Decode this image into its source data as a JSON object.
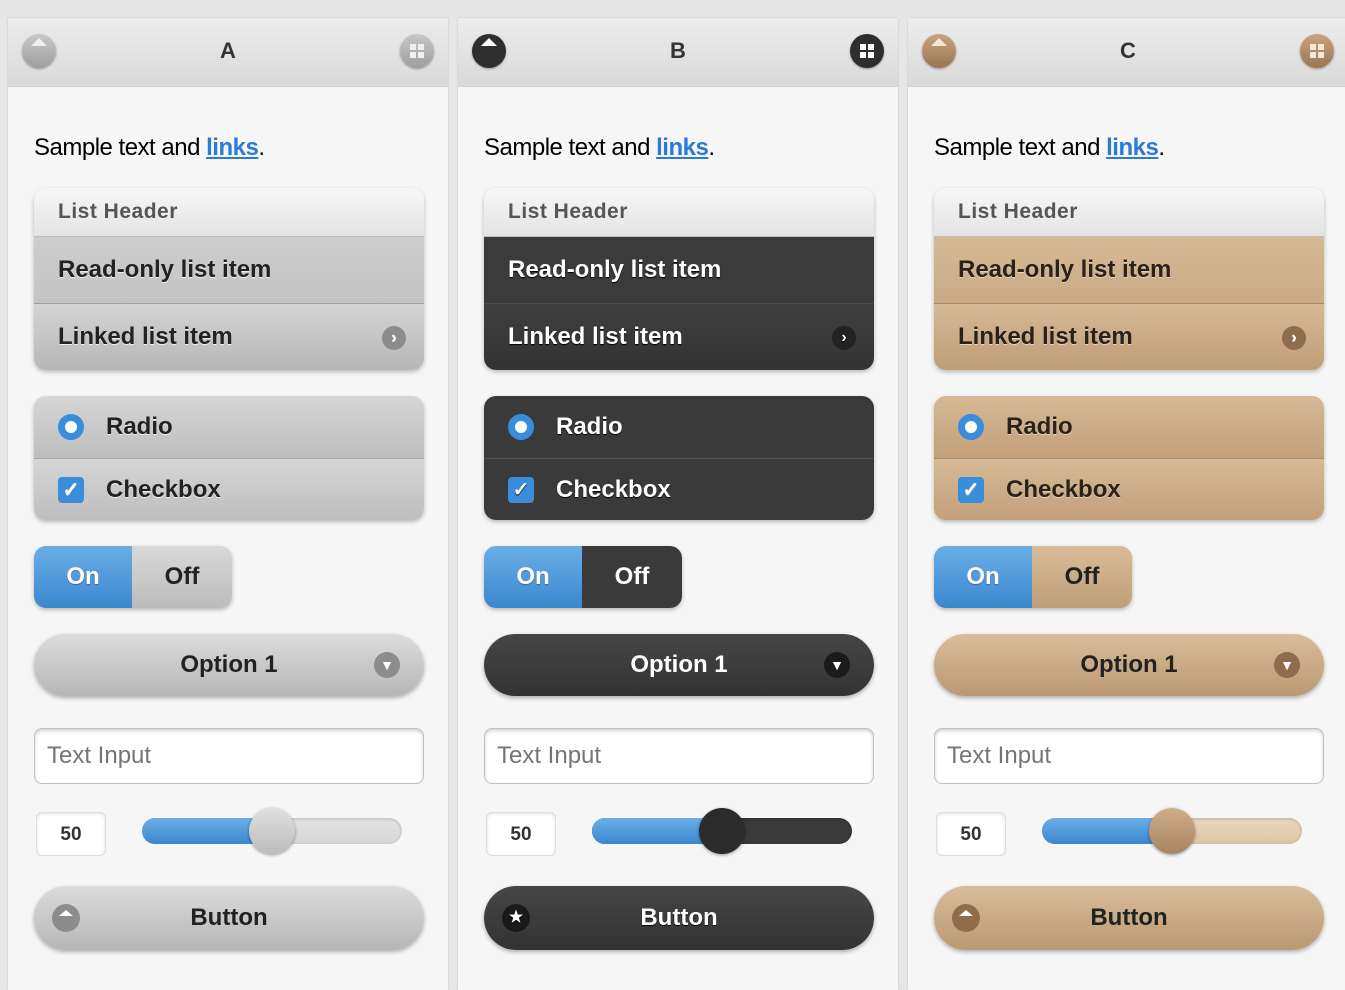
{
  "panels": [
    {
      "theme": "A",
      "title": "A",
      "sample_text": "Sample text and ",
      "link_text": "links",
      "sample_suffix": ".",
      "list_header": "List Header",
      "readonly_item": "Read-only list item",
      "linked_item": "Linked list item",
      "radio_label": "Radio",
      "checkbox_label": "Checkbox",
      "toggle_on": "On",
      "toggle_off": "Off",
      "select_value": "Option 1",
      "text_input_placeholder": "Text Input",
      "slider_value": "50",
      "slider_fraction": 0.5,
      "button_label": "Button",
      "icons": {
        "header_left": "home-icon",
        "header_right": "grid-icon",
        "list_arrow": "arrow-right-icon",
        "select": "chevron-down-icon",
        "button": "home-icon"
      },
      "colors": {
        "accent": "#3b87cf",
        "swatch": "#bdbdbd"
      }
    },
    {
      "theme": "B",
      "title": "B",
      "sample_text": "Sample text and ",
      "link_text": "links",
      "sample_suffix": ".",
      "list_header": "List Header",
      "readonly_item": "Read-only list item",
      "linked_item": "Linked list item",
      "radio_label": "Radio",
      "checkbox_label": "Checkbox",
      "toggle_on": "On",
      "toggle_off": "Off",
      "select_value": "Option 1",
      "text_input_placeholder": "Text Input",
      "slider_value": "50",
      "slider_fraction": 0.5,
      "button_label": "Button",
      "icons": {
        "header_left": "home-icon",
        "header_right": "grid-icon",
        "list_arrow": "arrow-right-icon",
        "select": "chevron-down-icon",
        "button": "star-icon"
      },
      "colors": {
        "accent": "#3b87cf",
        "swatch": "#3a3a3a"
      }
    },
    {
      "theme": "C",
      "title": "C",
      "sample_text": "Sample text and ",
      "link_text": "links",
      "sample_suffix": ".",
      "list_header": "List Header",
      "readonly_item": "Read-only list item",
      "linked_item": "Linked list item",
      "radio_label": "Radio",
      "checkbox_label": "Checkbox",
      "toggle_on": "On",
      "toggle_off": "Off",
      "select_value": "Option 1",
      "text_input_placeholder": "Text Input",
      "slider_value": "50",
      "slider_fraction": 0.5,
      "button_label": "Button",
      "icons": {
        "header_left": "home-icon",
        "header_right": "grid-icon",
        "list_arrow": "arrow-right-icon",
        "select": "chevron-down-icon",
        "button": "home-icon"
      },
      "colors": {
        "accent": "#3b87cf",
        "swatch": "#c9aa85"
      }
    }
  ]
}
